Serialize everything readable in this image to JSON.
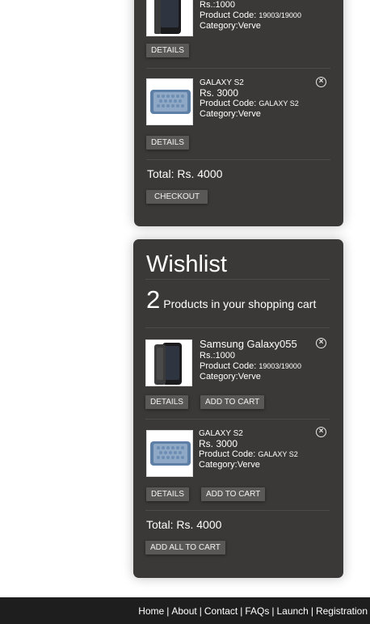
{
  "cart": {
    "items": [
      {
        "price": "Rs.:1000",
        "code_label": "Product Code:",
        "code": "19003/19000",
        "category": "Category:Verve",
        "details_label": "DETAILS"
      },
      {
        "name": "GALAXY S2",
        "price": "Rs. 3000",
        "code_label": "Product Code:",
        "code": "GALAXY S2",
        "category": "Category:Verve",
        "details_label": "DETAILS",
        "remove_icon": "close-circle-icon"
      }
    ],
    "total": "Total: Rs. 4000",
    "checkout_label": "CHECKOUT"
  },
  "wishlist": {
    "title": "Wishlist",
    "count": "2",
    "count_text": "Products in your shopping cart",
    "items": [
      {
        "name": "Samsung Galaxy055",
        "price": "Rs.:1000",
        "code_label": "Product Code:",
        "code": "19003/19000",
        "category": "Category:Verve",
        "details_label": "DETAILS",
        "add_label": "ADD TO CART",
        "remove_icon": "close-circle-icon"
      },
      {
        "name": "GALAXY S2",
        "price": "Rs. 3000",
        "code_label": "Product Code:",
        "code": "GALAXY S2",
        "category": "Category:Verve",
        "details_label": "DETAILS",
        "add_label": "ADD TO CART",
        "remove_icon": "close-circle-icon"
      }
    ],
    "total": "Total: Rs. 4000",
    "add_all_label": "ADD ALL TO CART"
  },
  "footer": {
    "links": [
      "Home",
      "About",
      "Contact",
      "FAQs",
      "Launch",
      "Registration"
    ],
    "separator": "|"
  },
  "colors": {
    "panel": "#3b3938",
    "button": "#5a5857",
    "footer": "#1f1e1e"
  }
}
